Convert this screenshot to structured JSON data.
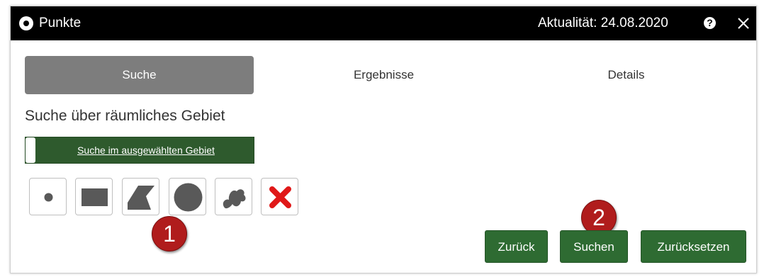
{
  "window": {
    "title": "Punkte",
    "aktualitaet": "Aktualität: 24.08.2020",
    "help_glyph": "?",
    "icons": [
      "target-icon",
      "help-icon",
      "close-icon"
    ]
  },
  "tabs": [
    {
      "label": "Suche",
      "active": true
    },
    {
      "label": "Ergebnisse",
      "active": false
    },
    {
      "label": "Details",
      "active": false
    }
  ],
  "search": {
    "section_title": "Suche über räumliches Gebiet",
    "toggle_label": "Suche im ausgewählten Gebiet",
    "tools": [
      "point-icon",
      "rectangle-icon",
      "polygon-icon",
      "circle-icon",
      "freehand-icon",
      "delete-icon"
    ]
  },
  "markers": [
    "1",
    "2"
  ],
  "buttons": {
    "back": "Zurück",
    "search": "Suchen",
    "reset": "Zurücksetzen"
  },
  "colors": {
    "titlebar": "#000000",
    "active_tab": "#7d7d7d",
    "green": "#2e6b32",
    "toggle_green": "#2e5a2d",
    "marker_red": "#b01c1c",
    "delete_red": "#e01818",
    "tool_gray": "#595959"
  }
}
